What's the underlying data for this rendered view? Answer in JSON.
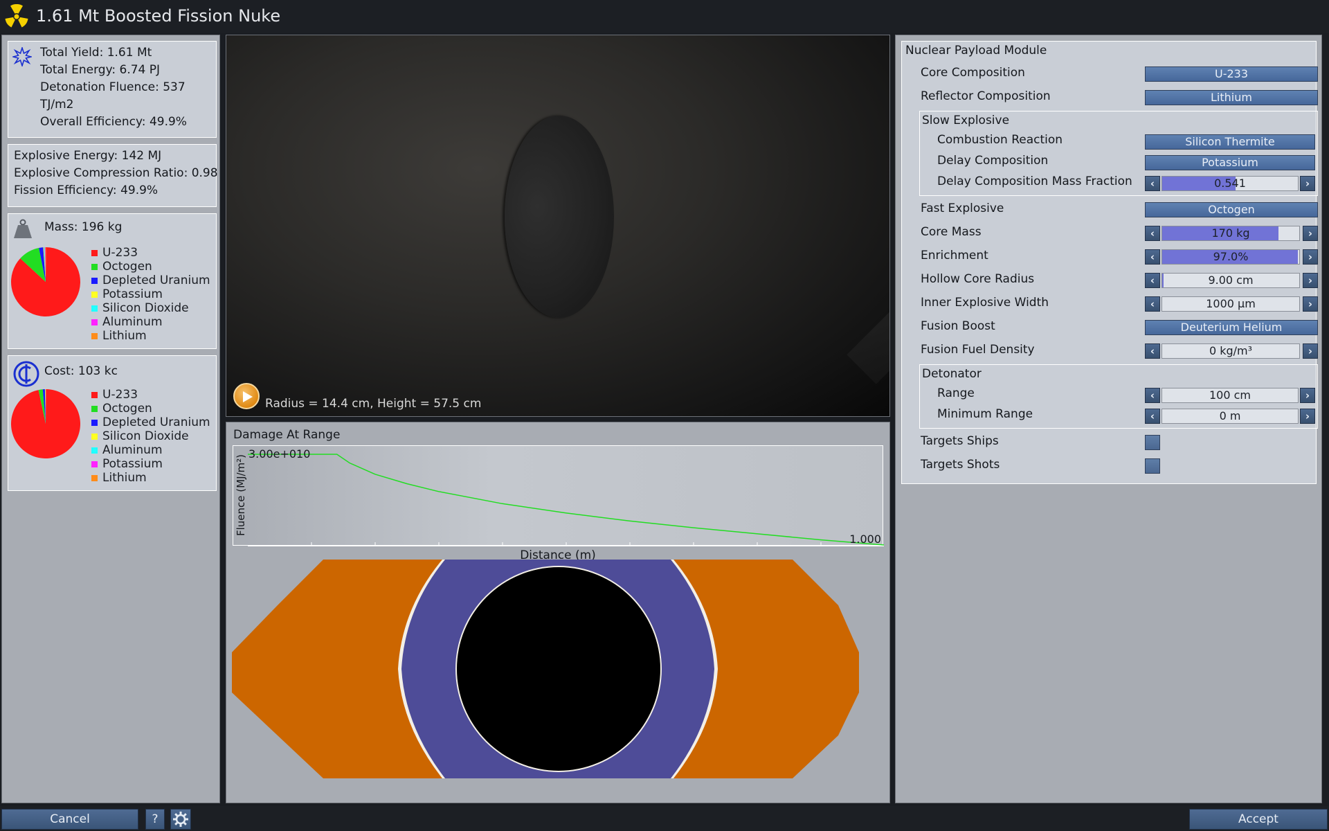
{
  "window": {
    "title": "1.61 Mt Boosted Fission Nuke",
    "icon": "radiation-icon"
  },
  "summary": {
    "icon": "starburst-icon",
    "lines": [
      "Total Yield: 1.61 Mt",
      "Total Energy: 6.74 PJ",
      "Detonation Fluence: 537",
      "TJ/m2",
      "Overall Efficiency: 49.9%"
    ]
  },
  "explosive": {
    "lines": [
      "Explosive Energy: 142 MJ",
      "Explosive Compression Ratio: 0.98",
      "Fission Efficiency: 49.9%"
    ]
  },
  "mass": {
    "icon": "weight-icon",
    "label": "Mass: 196 kg",
    "legend": [
      {
        "name": "U-233",
        "color": "#ff1a1a"
      },
      {
        "name": "Octogen",
        "color": "#22dd22"
      },
      {
        "name": "Depleted Uranium",
        "color": "#1a1aff"
      },
      {
        "name": "Potassium",
        "color": "#ffff22"
      },
      {
        "name": "Silicon Dioxide",
        "color": "#22ffff"
      },
      {
        "name": "Aluminum",
        "color": "#ff22ff"
      },
      {
        "name": "Lithium",
        "color": "#ff8c1a"
      }
    ],
    "pie_fractions": [
      0.867,
      0.1,
      0.02,
      0.003,
      0.004,
      0.003,
      0.003
    ]
  },
  "cost": {
    "icon": "credits-icon",
    "label": "Cost: 103 kc",
    "legend": [
      {
        "name": "U-233",
        "color": "#ff1a1a"
      },
      {
        "name": "Octogen",
        "color": "#22dd22"
      },
      {
        "name": "Depleted Uranium",
        "color": "#1a1aff"
      },
      {
        "name": "Silicon Dioxide",
        "color": "#ffff22"
      },
      {
        "name": "Aluminum",
        "color": "#22ffff"
      },
      {
        "name": "Potassium",
        "color": "#ff22ff"
      },
      {
        "name": "Lithium",
        "color": "#ff8c1a"
      }
    ],
    "pie_fractions": [
      0.965,
      0.02,
      0.01,
      0.002,
      0.001,
      0.001,
      0.001
    ]
  },
  "view": {
    "caption": "Radius = 14.4 cm, Height = 57.5 cm",
    "play_icon": "play-icon"
  },
  "damage": {
    "title": "Damage At Range",
    "ylabel": "Fluence (MJ/m²)",
    "xlabel": "Distance (m)",
    "ymax_label": "3.00e+010",
    "ymin_label": "1.000",
    "curve_color": "#22dd22"
  },
  "chart_data": {
    "type": "line",
    "title": "Damage At Range",
    "xlabel": "Distance (m)",
    "ylabel": "Fluence (MJ/m²)",
    "yscale": "log",
    "ylim": [
      1.0,
      30000000000
    ],
    "grid": false,
    "series": [
      {
        "x": [
          0,
          0.14,
          0.16,
          0.2,
          0.25,
          0.3,
          0.4,
          0.5,
          0.6,
          0.7,
          0.8,
          0.9,
          1.0
        ],
        "values": [
          30000000000,
          30000000000,
          3000000000,
          150000000,
          12000000,
          1500000,
          60000,
          5000,
          600,
          100,
          20,
          4,
          1.0
        ]
      }
    ]
  },
  "cross_section": {
    "colors": {
      "outer": "#cc6600",
      "middle": "#4e4c98",
      "core": "#000000",
      "edge": "#f3efe6"
    }
  },
  "module": {
    "title": "Nuclear Payload Module",
    "core_composition": {
      "label": "Core Composition",
      "value": "U-233"
    },
    "reflector_composition": {
      "label": "Reflector Composition",
      "value": "Lithium"
    },
    "slow_explosive": {
      "title": "Slow Explosive",
      "combustion_reaction": {
        "label": "Combustion Reaction",
        "value": "Silicon Thermite"
      },
      "delay_composition": {
        "label": "Delay Composition",
        "value": "Potassium"
      },
      "delay_mass_fraction": {
        "label": "Delay Composition Mass Fraction",
        "value": "0.541",
        "fill": 0.541
      }
    },
    "fast_explosive": {
      "label": "Fast Explosive",
      "value": "Octogen"
    },
    "core_mass": {
      "label": "Core Mass",
      "value": "170 kg",
      "fill": 0.85
    },
    "enrichment": {
      "label": "Enrichment",
      "value": "97.0%",
      "fill": 0.99
    },
    "hollow_core_radius": {
      "label": "Hollow Core Radius",
      "value": "9.00 cm",
      "fill": 0.01
    },
    "inner_explosive_width": {
      "label": "Inner Explosive Width",
      "value": "1000 μm",
      "fill": 0.0
    },
    "fusion_boost": {
      "label": "Fusion Boost",
      "value": "Deuterium Helium"
    },
    "fusion_fuel_density": {
      "label": "Fusion Fuel Density",
      "value": "0 kg/m³",
      "fill": 0.0
    },
    "detonator": {
      "title": "Detonator",
      "range": {
        "label": "Range",
        "value": "100 cm",
        "fill": 0.0
      },
      "minimum_range": {
        "label": "Minimum Range",
        "value": "0 m",
        "fill": 0.0
      }
    },
    "targets_ships": {
      "label": "Targets Ships"
    },
    "targets_shots": {
      "label": "Targets Shots"
    },
    "arrow_left": "‹",
    "arrow_right": "›"
  },
  "footer": {
    "cancel": "Cancel",
    "help": "?",
    "settings_icon": "gear-icon",
    "accept": "Accept"
  }
}
